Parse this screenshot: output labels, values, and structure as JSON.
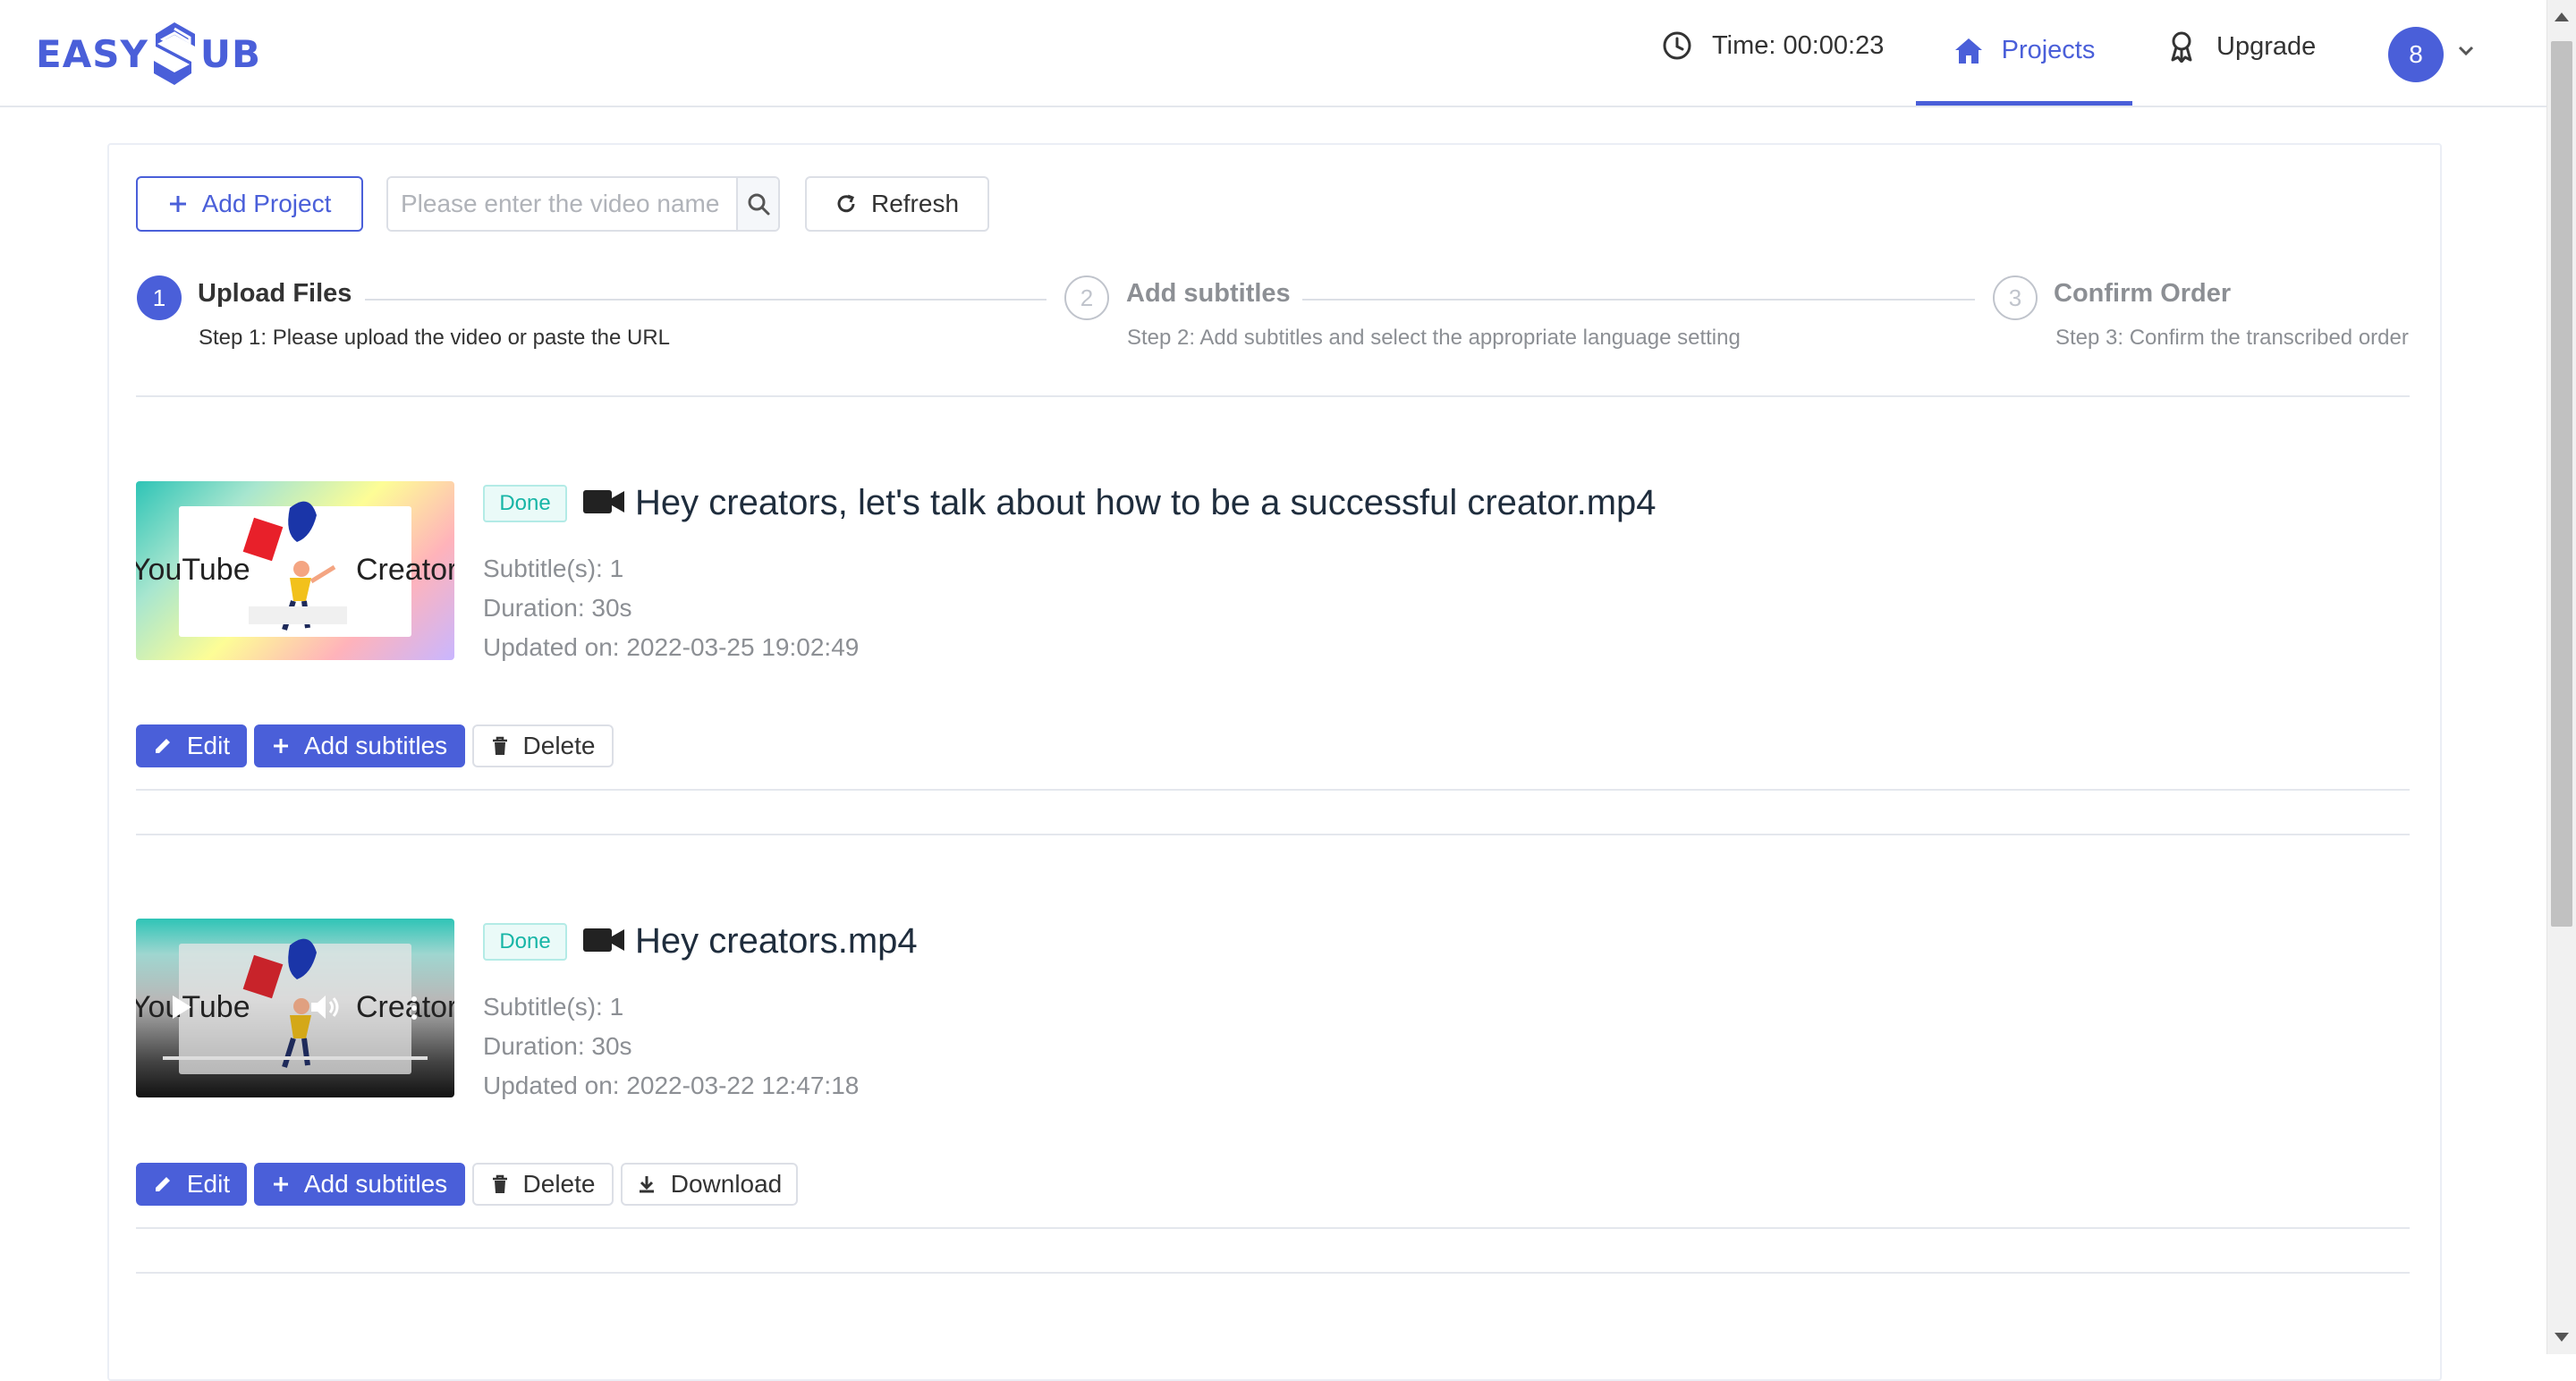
{
  "header": {
    "logo_left": "EASY",
    "logo_right": "UB",
    "time_label": "Time: 00:00:23",
    "projects_label": "Projects",
    "upgrade_label": "Upgrade",
    "avatar_initial": "8"
  },
  "toolbar": {
    "add_project_label": "Add Project",
    "search_placeholder": "Please enter the video name",
    "refresh_label": "Refresh"
  },
  "steps": [
    {
      "number": "1",
      "title": "Upload Files",
      "desc": "Step 1: Please upload the video or paste the URL",
      "active": true
    },
    {
      "number": "2",
      "title": "Add subtitles",
      "desc": "Step 2: Add subtitles and select the appropriate language setting",
      "active": false
    },
    {
      "number": "3",
      "title": "Confirm Order",
      "desc": "Step 3: Confirm the transcribed order",
      "active": false
    }
  ],
  "projects": [
    {
      "status": "Done",
      "title": "Hey creators, let's talk about how to be a successful creator.mp4",
      "subtitles": "Subtitle(s): 1",
      "duration": "Duration: 30s",
      "updated": "Updated on: 2022-03-25 19:02:49",
      "thumb_left_text": "YouTube",
      "thumb_right_text": "Creator",
      "actions": {
        "edit": "Edit",
        "add_subtitles": "Add subtitles",
        "delete": "Delete"
      }
    },
    {
      "status": "Done",
      "title": "Hey creators.mp4",
      "subtitles": "Subtitle(s): 1",
      "duration": "Duration: 30s",
      "updated": "Updated on: 2022-03-22 12:47:18",
      "thumb_left_text": "YouTube",
      "thumb_right_text": "Creator",
      "actions": {
        "edit": "Edit",
        "add_subtitles": "Add subtitles",
        "delete": "Delete",
        "download": "Download"
      }
    }
  ],
  "colors": {
    "accent": "#4a5fd9",
    "done_text": "#17b5a6",
    "done_bg": "#eafaf8"
  }
}
